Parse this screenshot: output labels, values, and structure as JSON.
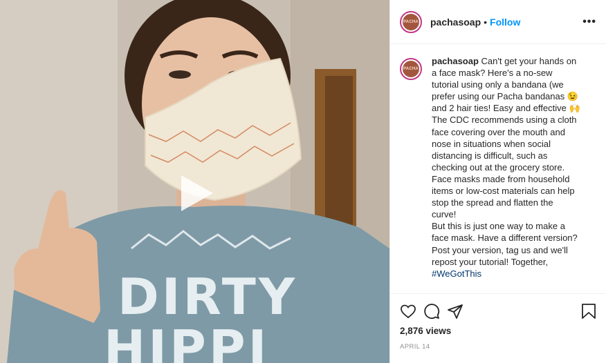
{
  "post": {
    "username": "pachasoap",
    "follow_label": "Follow",
    "separator": "•",
    "more_label": "•••",
    "avatar_text": "PACHA",
    "caption_lines": [
      "Can't get your hands on",
      "a face mask? Here's a no-sew",
      "tutorial using only a bandana (we",
      "prefer using our Pacha bandanas 😉",
      "and 2 hair ties! Easy and effective 🙌",
      "The CDC recommends using a cloth",
      "face covering over the mouth and",
      "nose in situations when social",
      "distancing is difficult, such as",
      "checking out at the grocery store.",
      "Face masks made from household",
      "items or low-cost materials can help",
      "stop the spread and flatten the",
      "curve!",
      "But this is just one way to make a",
      "face mask. Have a different version?",
      "Post your version, tag us and we'll",
      "repost your tutorial! Together,"
    ],
    "hashtag": "#WeGotThis",
    "views": "2,876 views",
    "date": "APRIL 14",
    "shirt_text": [
      "DIRTY",
      "HIPPI"
    ]
  },
  "colors": {
    "follow": "#0095f6",
    "avatar_ring": "#c13584",
    "shirt": "#7e9aa6",
    "mask": "#f1e7d5"
  },
  "icons": [
    "heart-icon",
    "comment-icon",
    "share-icon",
    "bookmark-icon",
    "play-icon",
    "more-icon"
  ]
}
